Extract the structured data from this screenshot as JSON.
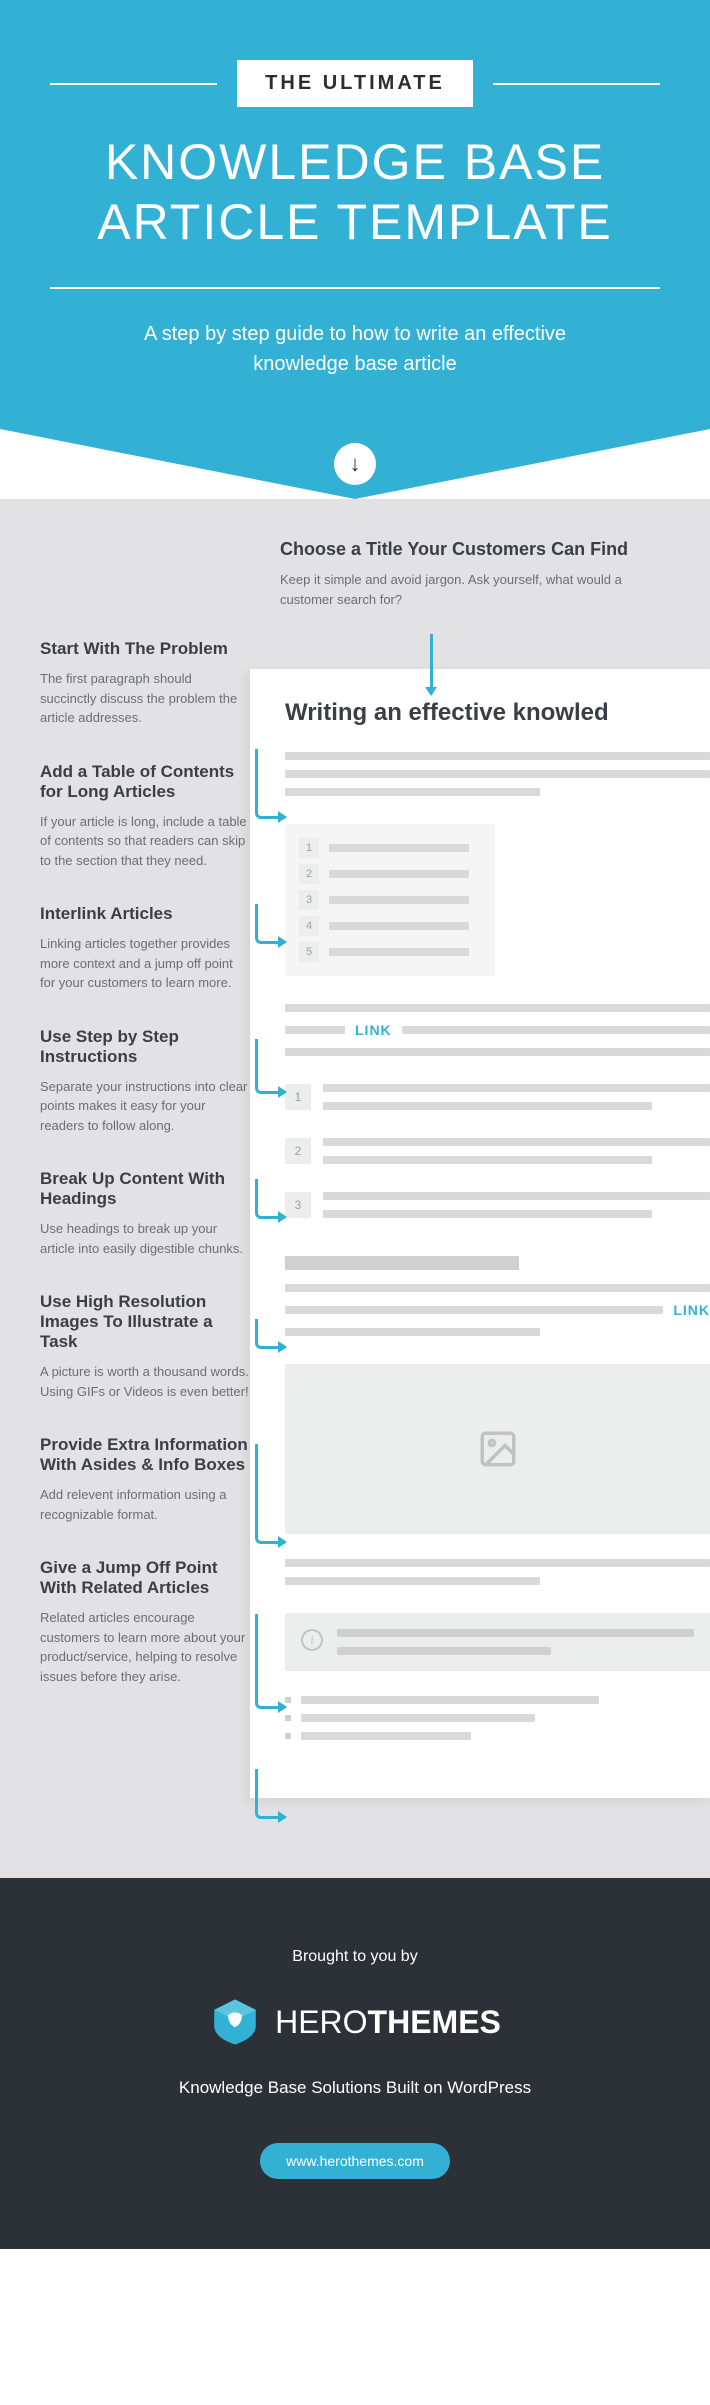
{
  "hero": {
    "badge": "THE ULTIMATE",
    "title": "KNOWLEDGE BASE ARTICLE TEMPLATE",
    "subtitle": "A step by step guide to how to write an effective knowledge base article"
  },
  "top_tip": {
    "title": "Choose a Title Your Customers Can Find",
    "desc": "Keep it simple and avoid jargon. Ask yourself, what would a customer search for?"
  },
  "tips": [
    {
      "title": "Start With The Problem",
      "desc": "The first paragraph should succinctly discuss the problem the article addresses."
    },
    {
      "title": "Add a Table of Contents for Long Articles",
      "desc": "If your article is long, include a table of contents so that readers can skip to the section that they need."
    },
    {
      "title": "Interlink Articles",
      "desc": "Linking articles together provides more context and a jump off point for your customers to learn more."
    },
    {
      "title": "Use Step by Step Instructions",
      "desc": "Separate your instructions into clear points makes it easy for your readers to follow along."
    },
    {
      "title": "Break Up Content With Headings",
      "desc": "Use headings to break up your article into easily digestible chunks."
    },
    {
      "title": "Use High Resolution Images To Illustrate a Task",
      "desc": "A picture is worth a thousand words. Using GIFs or Videos is even better!"
    },
    {
      "title": "Provide Extra Information With Asides & Info Boxes",
      "desc": "Add relevent information using a recognizable format."
    },
    {
      "title": "Give a Jump Off Point With Related Articles",
      "desc": "Related articles encourage customers to learn more about your product/service, helping to resolve issues before they arise."
    }
  ],
  "preview": {
    "heading": "Writing an effective knowled",
    "link_label": "LINK",
    "toc_nums": [
      "1",
      "2",
      "3",
      "4",
      "5"
    ],
    "step_nums": [
      "1",
      "2",
      "3"
    ]
  },
  "footer": {
    "brought": "Brought to you by",
    "logo_light": "HERO",
    "logo_bold": "THEMES",
    "tagline": "Knowledge Base Solutions Built on WordPress",
    "url": "www.herothemes.com"
  }
}
